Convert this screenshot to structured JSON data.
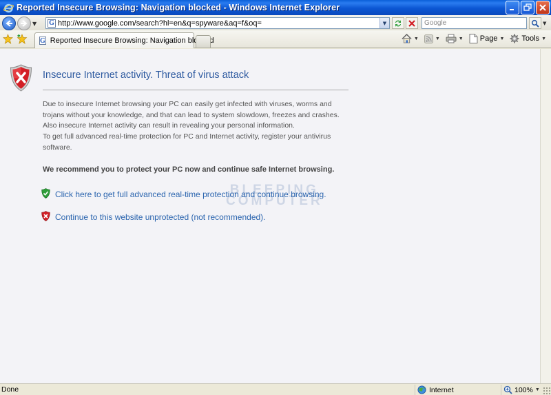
{
  "window": {
    "title": "Reported Insecure Browsing: Navigation blocked - Windows Internet Explorer"
  },
  "address_bar": {
    "url": "http://www.google.com/search?hl=en&q=spyware&aq=f&oq="
  },
  "search": {
    "placeholder": "Google"
  },
  "tabs": [
    {
      "label": "Reported Insecure Browsing: Navigation blocked",
      "active": true
    }
  ],
  "command_bar": {
    "page_label": "Page",
    "tools_label": "Tools"
  },
  "content": {
    "headline": "Insecure Internet activity. Threat of virus attack",
    "paragraphs": [
      "Due to insecure Internet browsing your PC can easily get infected with viruses, worms and trojans without your knowledge, and that can lead to system slowdown, freezes and crashes.",
      "Also insecure Internet activity can result in revealing your personal information.",
      "To get full advanced real-time protection for PC and Internet activity, register your antivirus software."
    ],
    "recommendation": "We recommend you to protect your PC now and continue safe Internet browsing.",
    "link_protect": "Click here to get full advanced real-time protection and continue browsing.",
    "link_continue": "Continue to this website unprotected (not recommended).",
    "watermark_line1": "BLEEPING",
    "watermark_line2": "COMPUTER"
  },
  "status_bar": {
    "status": "Done",
    "zone": "Internet",
    "zoom": "100%"
  },
  "colors": {
    "headline": "#2e5aa0",
    "link": "#2a64ae",
    "shield_red": "#d21f26",
    "shield_green": "#2e9e3a"
  }
}
